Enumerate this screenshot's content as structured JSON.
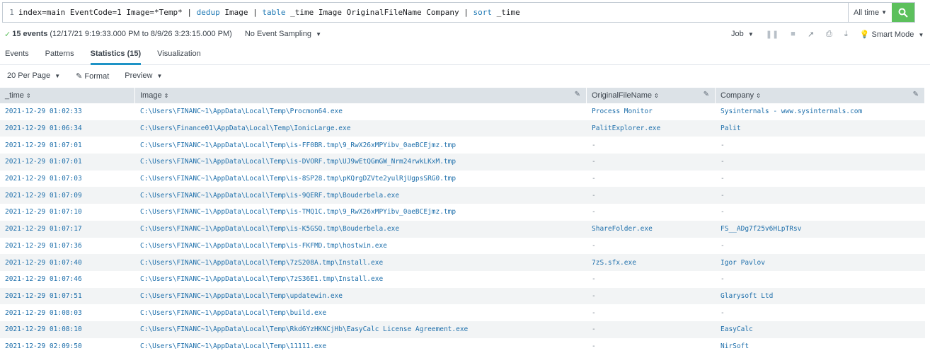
{
  "search": {
    "line_number": "1",
    "query_tokens": [
      {
        "text": "index=main EventCode=1 Image=*Temp* ",
        "kind": "plain"
      },
      {
        "text": "| ",
        "kind": "pipe"
      },
      {
        "text": "dedup",
        "kind": "cmd"
      },
      {
        "text": " Image ",
        "kind": "plain"
      },
      {
        "text": "| ",
        "kind": "pipe"
      },
      {
        "text": "table",
        "kind": "cmd"
      },
      {
        "text": " _time Image OriginalFileName Company ",
        "kind": "plain"
      },
      {
        "text": "| ",
        "kind": "pipe"
      },
      {
        "text": "sort",
        "kind": "cmd"
      },
      {
        "text": " _time",
        "kind": "plain"
      }
    ],
    "time_range": "All time",
    "search_icon": "magnifier-icon"
  },
  "status": {
    "check": "✓",
    "count": "15 events",
    "range": "(12/17/21 9:19:33.000 PM to 8/9/26 3:23:15.000 PM)",
    "sampling": "No Event Sampling",
    "job": "Job",
    "smart_mode": "Smart Mode"
  },
  "tabs": [
    "Events",
    "Patterns",
    "Statistics (15)",
    "Visualization"
  ],
  "active_tab": 2,
  "controls": {
    "per_page": "20 Per Page",
    "format": "Format",
    "preview": "Preview"
  },
  "table": {
    "headers": [
      "_time",
      "Image",
      "OriginalFileName",
      "Company"
    ],
    "rows": [
      [
        "2021-12-29 01:02:33",
        "C:\\Users\\FINANC~1\\AppData\\Local\\Temp\\Procmon64.exe",
        "Process Monitor",
        "Sysinternals - www.sysinternals.com"
      ],
      [
        "2021-12-29 01:06:34",
        "C:\\Users\\Finance01\\AppData\\Local\\Temp\\IonicLarge.exe",
        "PalitExplorer.exe",
        "Palit"
      ],
      [
        "2021-12-29 01:07:01",
        "C:\\Users\\FINANC~1\\AppData\\Local\\Temp\\is-FF0BR.tmp\\9_RwX26xMPYibv_0aeBCEjmz.tmp",
        "-",
        "-"
      ],
      [
        "2021-12-29 01:07:01",
        "C:\\Users\\FINANC~1\\AppData\\Local\\Temp\\is-DVORF.tmp\\UJ9wEtQGmGW_Nrm24rwkLKxM.tmp",
        "-",
        "-"
      ],
      [
        "2021-12-29 01:07:03",
        "C:\\Users\\FINANC~1\\AppData\\Local\\Temp\\is-8SP28.tmp\\pKQrgDZVte2yulRjUgpsSRG0.tmp",
        "-",
        "-"
      ],
      [
        "2021-12-29 01:07:09",
        "C:\\Users\\FINANC~1\\AppData\\Local\\Temp\\is-9QERF.tmp\\Bouderbela.exe",
        "-",
        "-"
      ],
      [
        "2021-12-29 01:07:10",
        "C:\\Users\\FINANC~1\\AppData\\Local\\Temp\\is-TMQ1C.tmp\\9_RwX26xMPYibv_0aeBCEjmz.tmp",
        "-",
        "-"
      ],
      [
        "2021-12-29 01:07:17",
        "C:\\Users\\FINANC~1\\AppData\\Local\\Temp\\is-K5GSQ.tmp\\Bouderbela.exe",
        "ShareFolder.exe",
        "FS__ADg7f25v6HLpTRsv"
      ],
      [
        "2021-12-29 01:07:36",
        "C:\\Users\\FINANC~1\\AppData\\Local\\Temp\\is-FKFMD.tmp\\hostwin.exe",
        "-",
        "-"
      ],
      [
        "2021-12-29 01:07:40",
        "C:\\Users\\FINANC~1\\AppData\\Local\\Temp\\7zS208A.tmp\\Install.exe",
        "7zS.sfx.exe",
        "Igor Pavlov"
      ],
      [
        "2021-12-29 01:07:46",
        "C:\\Users\\FINANC~1\\AppData\\Local\\Temp\\7zS36E1.tmp\\Install.exe",
        "-",
        "-"
      ],
      [
        "2021-12-29 01:07:51",
        "C:\\Users\\FINANC~1\\AppData\\Local\\Temp\\updatewin.exe",
        "-",
        "Glarysoft Ltd"
      ],
      [
        "2021-12-29 01:08:03",
        "C:\\Users\\FINANC~1\\AppData\\Local\\Temp\\build.exe",
        "-",
        "-"
      ],
      [
        "2021-12-29 01:08:10",
        "C:\\Users\\FINANC~1\\AppData\\Local\\Temp\\Rkd6YzHKNCjHb\\EasyCalc License Agreement.exe",
        "-",
        "EasyCalc"
      ],
      [
        "2021-12-29 02:09:50",
        "C:\\Users\\FINANC~1\\AppData\\Local\\Temp\\11111.exe",
        "-",
        "NirSoft"
      ]
    ]
  },
  "colors": {
    "accent": "#1e93c6",
    "search_button": "#5cc05c",
    "link": "#1e6fab",
    "header_bg": "#dce2e7"
  }
}
